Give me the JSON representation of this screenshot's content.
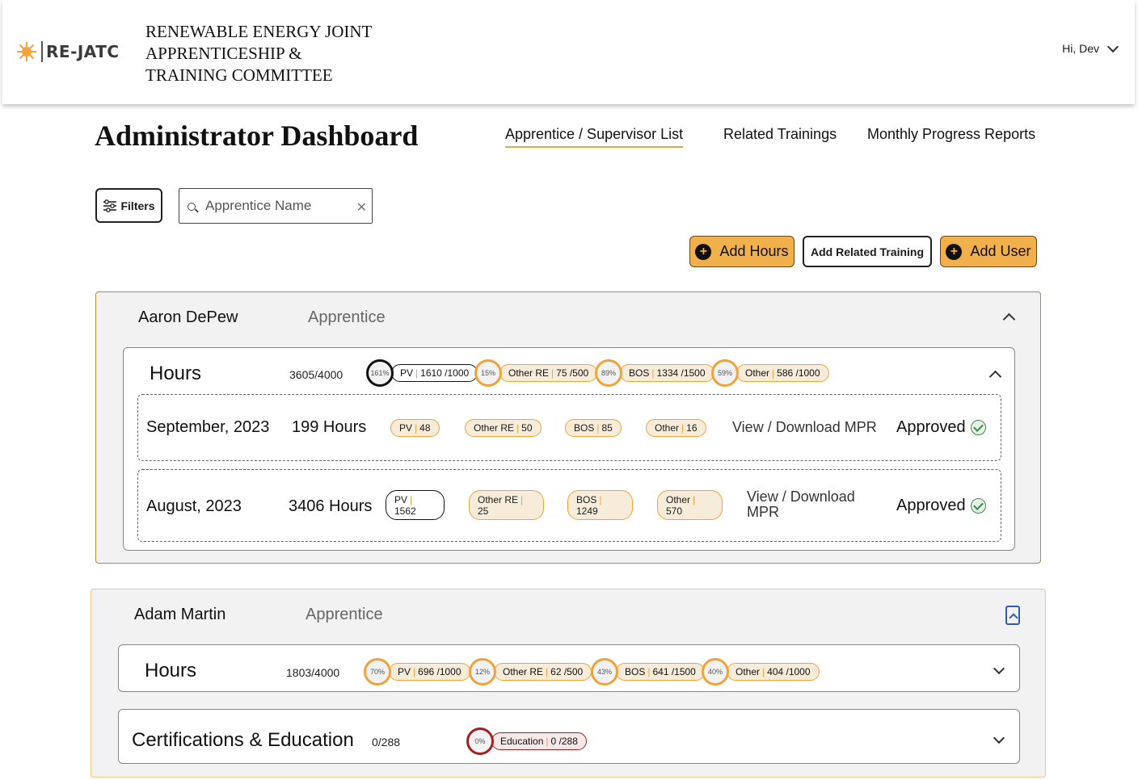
{
  "header": {
    "logo_abbr": "RE-JATC",
    "org_name_lines": [
      "RENEWABLE ENERGY JOINT",
      "APPRENTICESHIP &",
      "TRAINING COMMITTEE"
    ],
    "greeting": "Hi, Dev"
  },
  "page": {
    "title": "Administrator Dashboard",
    "tabs": [
      "Apprentice / Supervisor List",
      "Related Trainings",
      "Monthly Progress Reports"
    ],
    "active_tab": "Apprentice / Supervisor List"
  },
  "toolbar": {
    "filters_label": "Filters",
    "search_placeholder": "Apprentice Name",
    "add_hours_label": "Add Hours",
    "add_related_training_label": "Add Related Training",
    "add_user_label": "Add User"
  },
  "colors": {
    "accent": "#f0a33a",
    "button_fill": "#f2b04c",
    "overdue_ring": "#111111",
    "zero_ring": "#a32020",
    "approved": "#3b8a4a"
  },
  "people": [
    {
      "name": "Aaron DePew",
      "role": "Apprentice",
      "hours": {
        "title": "Hours",
        "total": "3605/4000",
        "categories": [
          {
            "pct": "161%",
            "label": "PV",
            "value": "1610 /1000"
          },
          {
            "pct": "15%",
            "label": "Other RE",
            "value": "75 /500"
          },
          {
            "pct": "89%",
            "label": "BOS",
            "value": "1334 /1500"
          },
          {
            "pct": "59%",
            "label": "Other",
            "value": "586 /1000"
          }
        ],
        "months": [
          {
            "date": "September, 2023",
            "hours": "199 Hours",
            "chips": [
              {
                "label": "PV",
                "value": "48"
              },
              {
                "label": "Other RE",
                "value": "50"
              },
              {
                "label": "BOS",
                "value": "85"
              },
              {
                "label": "Other",
                "value": "16"
              }
            ],
            "mpr_link": "View / Download MPR",
            "status": "Approved"
          },
          {
            "date": "August, 2023",
            "hours": "3406 Hours",
            "chips": [
              {
                "label": "PV",
                "value": "1562"
              },
              {
                "label": "Other RE",
                "value": "25"
              },
              {
                "label": "BOS",
                "value": "1249"
              },
              {
                "label": "Other",
                "value": "570"
              }
            ],
            "mpr_link_lines": [
              "View / Download",
              "MPR"
            ],
            "status": "Approved"
          }
        ]
      }
    },
    {
      "name": "Adam Martin",
      "role": "Apprentice",
      "hours": {
        "title": "Hours",
        "total": "1803/4000",
        "categories": [
          {
            "pct": "70%",
            "label": "PV",
            "value": "696 /1000"
          },
          {
            "pct": "12%",
            "label": "Other RE",
            "value": "62 /500"
          },
          {
            "pct": "43%",
            "label": "BOS",
            "value": "641 /1500"
          },
          {
            "pct": "40%",
            "label": "Other",
            "value": "404 /1000"
          }
        ]
      },
      "certifications": {
        "title": "Certifications & Education",
        "total": "0/288",
        "categories": [
          {
            "pct": "0%",
            "label": "Education",
            "value": "0 /288"
          }
        ]
      }
    }
  ]
}
